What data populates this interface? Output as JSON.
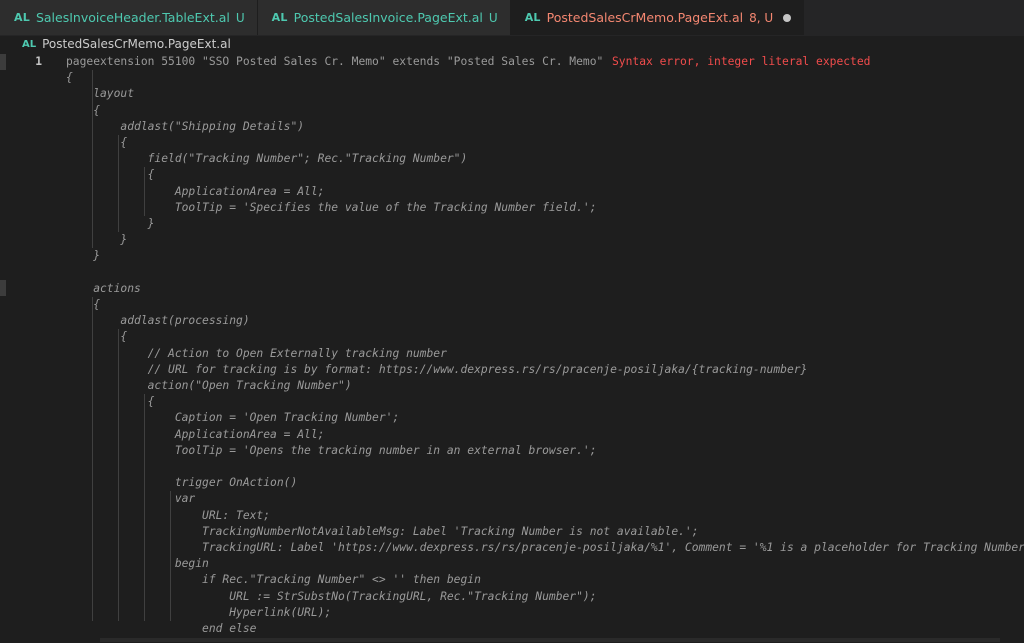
{
  "tabs": [
    {
      "badge_label": "AL",
      "title": "SalesInvoiceHeader.TableExt.al",
      "status": "U",
      "active": false
    },
    {
      "badge_label": "AL",
      "title": "PostedSalesInvoice.PageExt.al",
      "status": "U",
      "active": false
    },
    {
      "badge_label": "AL",
      "title": "PostedSalesCrMemo.PageExt.al",
      "status": "8, U",
      "active": true
    }
  ],
  "breadcrumb": {
    "badge_label": "AL",
    "file": "PostedSalesCrMemo.PageExt.al"
  },
  "editor": {
    "line_number": "1",
    "diagnostic": "Syntax error, integer literal expected",
    "lines": [
      "pageextension 55100 \"SSO Posted Sales Cr. Memo\" extends \"Posted Sales Cr. Memo\"",
      "{",
      "    layout",
      "    {",
      "        addlast(\"Shipping Details\")",
      "        {",
      "            field(\"Tracking Number\"; Rec.\"Tracking Number\")",
      "            {",
      "                ApplicationArea = All;",
      "                ToolTip = 'Specifies the value of the Tracking Number field.';",
      "            }",
      "        }",
      "    }",
      "",
      "    actions",
      "    {",
      "        addlast(processing)",
      "        {",
      "            // Action to Open Externally tracking number",
      "            // URL for tracking is by format: https://www.dexpress.rs/rs/pracenje-posiljaka/{tracking-number}",
      "            action(\"Open Tracking Number\")",
      "            {",
      "                Caption = 'Open Tracking Number';",
      "                ApplicationArea = All;",
      "                ToolTip = 'Opens the tracking number in an external browser.';",
      "",
      "                trigger OnAction()",
      "                var",
      "                    URL: Text;",
      "                    TrackingNumberNotAvailableMsg: Label 'Tracking Number is not available.';",
      "                    TrackingURL: Label 'https://www.dexpress.rs/rs/pracenje-posiljaka/%1', Comment = '%1 is a placeholder for Tracking Number';",
      "                begin",
      "                    if Rec.\"Tracking Number\" <> '' then begin",
      "                        URL := StrSubstNo(TrackingURL, Rec.\"Tracking Number\");",
      "                        Hyperlink(URL);",
      "                    end else"
    ]
  }
}
